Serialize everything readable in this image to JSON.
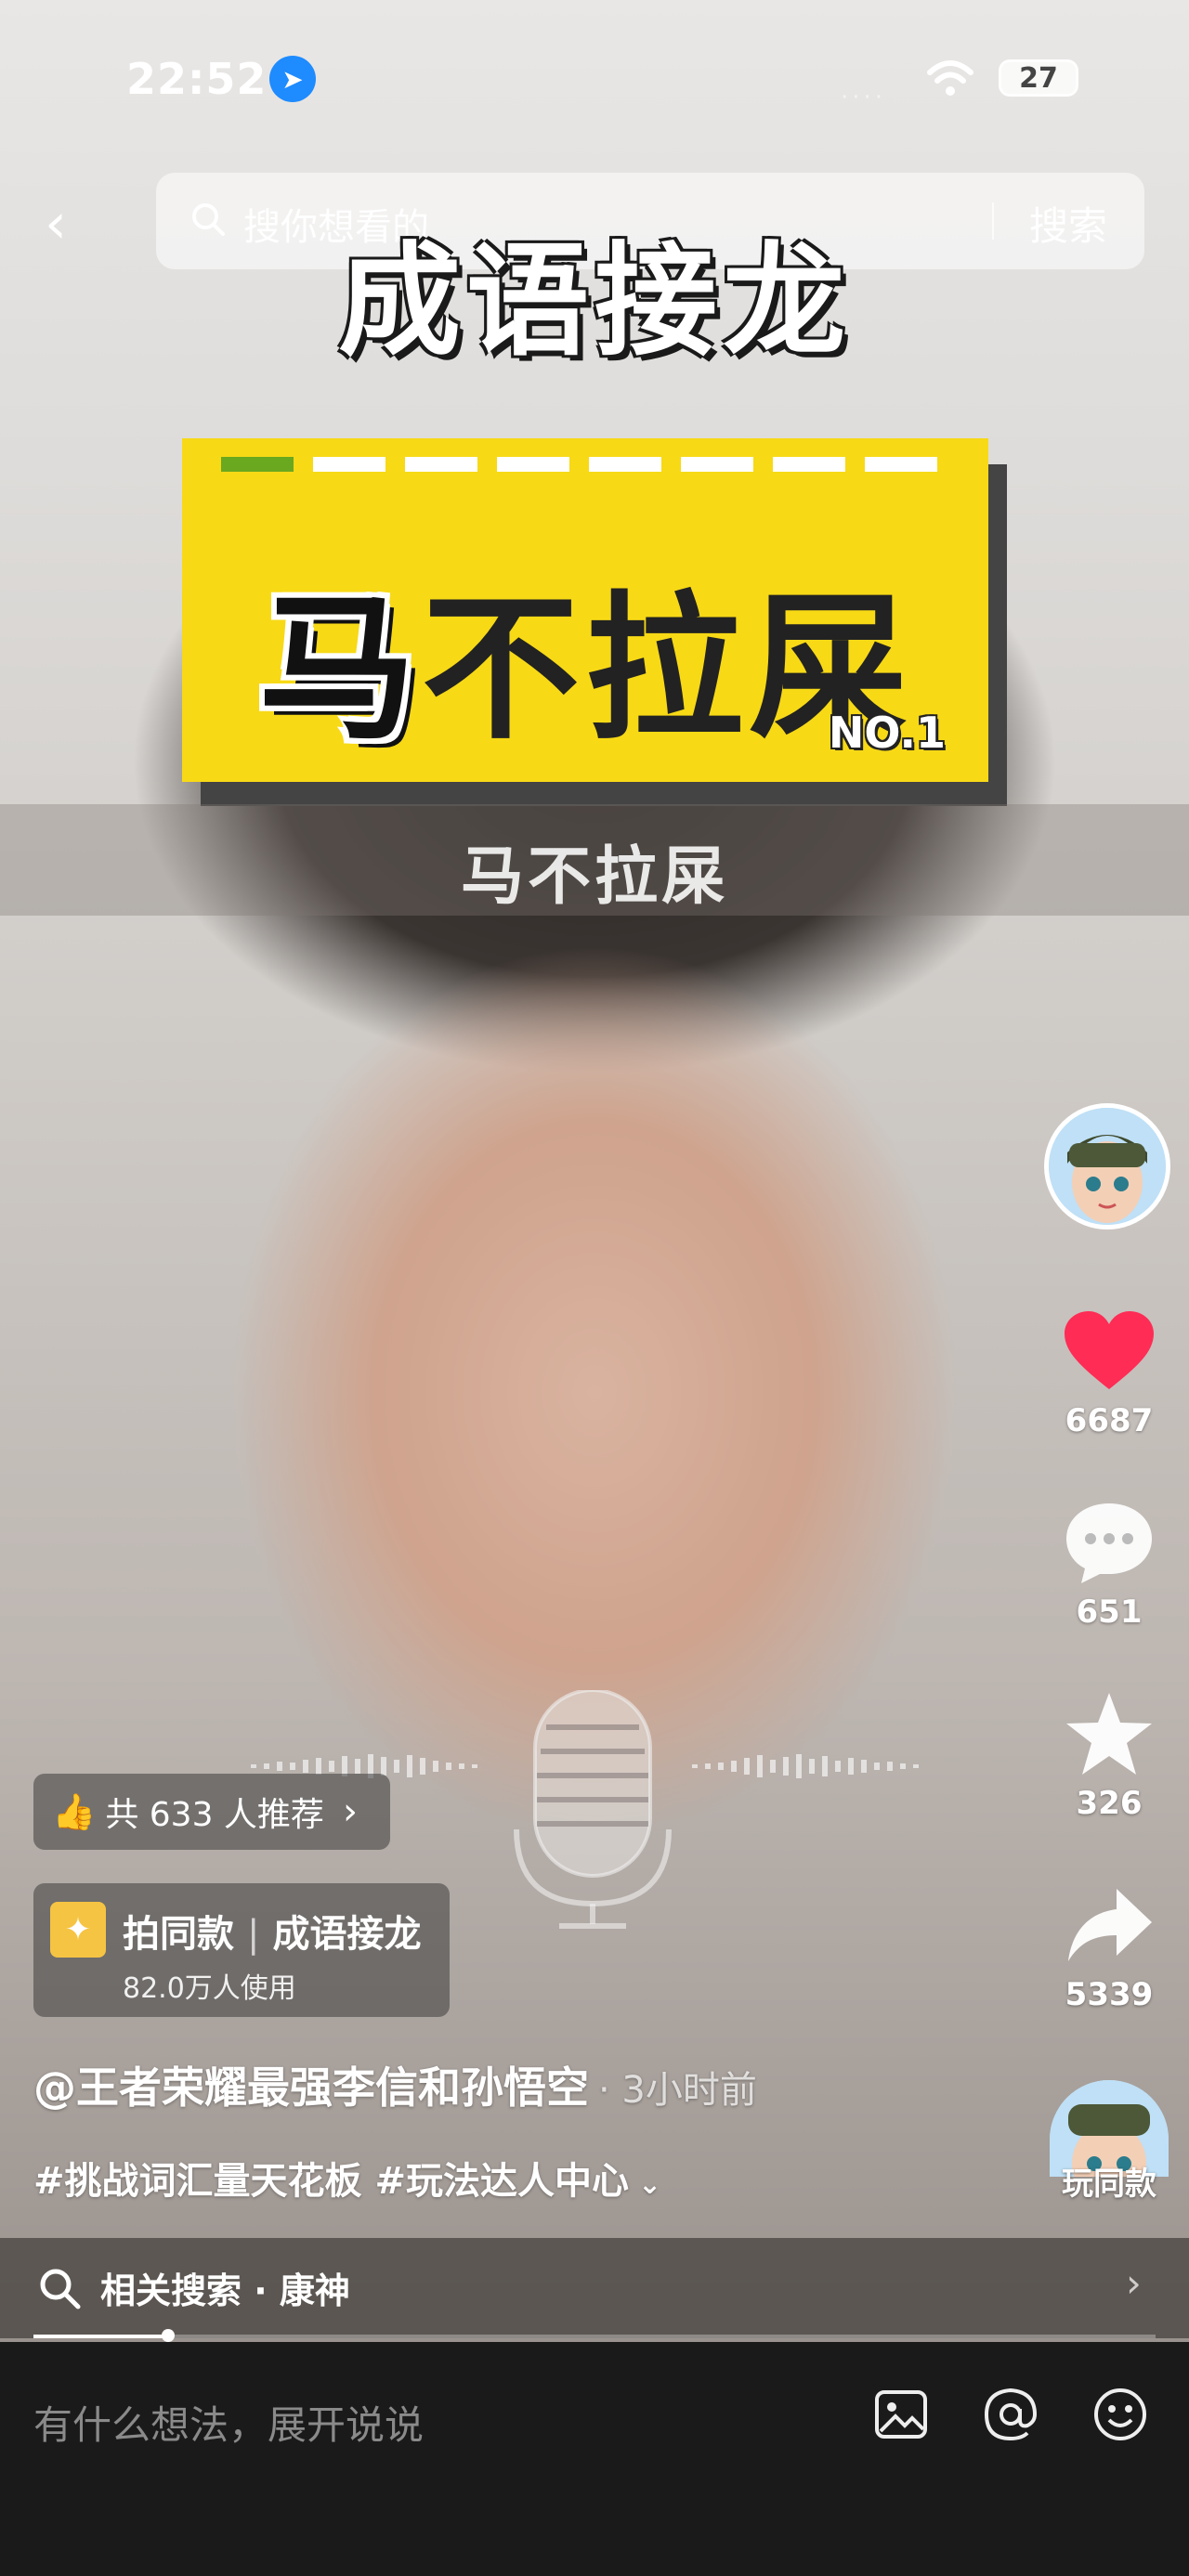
{
  "status_bar": {
    "time": "22:52",
    "battery": "27"
  },
  "search": {
    "placeholder": "搜你想看的",
    "button": "搜索"
  },
  "video": {
    "title": "成语接龙",
    "card_word_first": "马",
    "card_word_rest": "不拉屎",
    "card_number": "NO.1",
    "subtitle": "马不拉屎",
    "round_progress": {
      "current": 1,
      "total": 8
    }
  },
  "actions": {
    "likes": "6687",
    "comments": "651",
    "favorites": "326",
    "shares": "5339",
    "play_same": "玩同款"
  },
  "recommend": {
    "label": "共 633 人推荐"
  },
  "template": {
    "prefix": "拍同款",
    "name": "成语接龙",
    "users": "82.0万人使用"
  },
  "author": {
    "name": "@王者荣耀最强李信和孙悟空",
    "time": "· 3小时前"
  },
  "hashtags": "#挑战词汇量天花板 #玩法达人中心",
  "related_search": {
    "label": "相关搜索 · 康神"
  },
  "playback": {
    "progress": 0.12
  },
  "comment_bar": {
    "placeholder": "有什么想法，展开说说"
  },
  "colors": {
    "card_yellow": "#f7d916",
    "like_red": "#ff2c55",
    "progress_green": "#6aa820"
  }
}
